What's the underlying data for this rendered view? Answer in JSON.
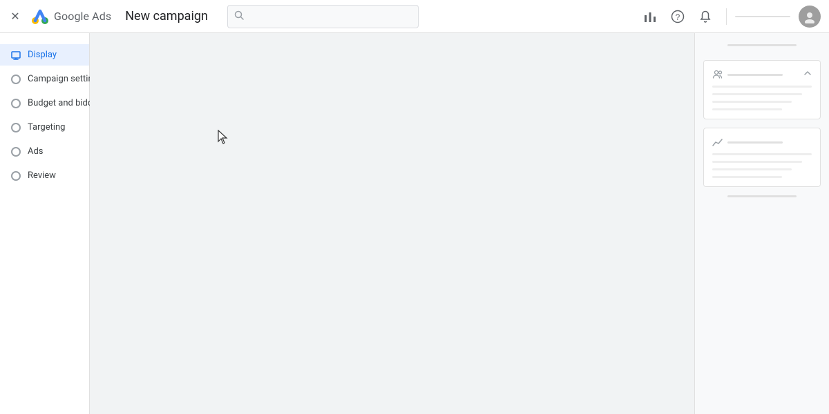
{
  "app": {
    "name": "Google Ads",
    "title": "New campaign",
    "logo_alt": "Google Ads Logo"
  },
  "header": {
    "close_label": "×",
    "search_placeholder": "",
    "icons": {
      "performance": "▦",
      "help": "?",
      "notification": "🔔"
    }
  },
  "sidebar": {
    "items": [
      {
        "id": "display",
        "label": "Display",
        "type": "icon",
        "active": true
      },
      {
        "id": "campaign-settings",
        "label": "Campaign settings",
        "type": "radio",
        "active": false
      },
      {
        "id": "budget-and-bidding",
        "label": "Budget and bidding",
        "type": "radio",
        "active": false
      },
      {
        "id": "targeting",
        "label": "Targeting",
        "type": "radio",
        "active": false
      },
      {
        "id": "ads",
        "label": "Ads",
        "type": "radio",
        "active": false
      },
      {
        "id": "review",
        "label": "Review",
        "type": "radio",
        "active": false
      }
    ]
  },
  "right_panel": {
    "cards": [
      {
        "id": "card-1",
        "icon": "people",
        "has_chevron": true
      },
      {
        "id": "card-2",
        "icon": "chart",
        "has_chevron": false
      }
    ]
  }
}
